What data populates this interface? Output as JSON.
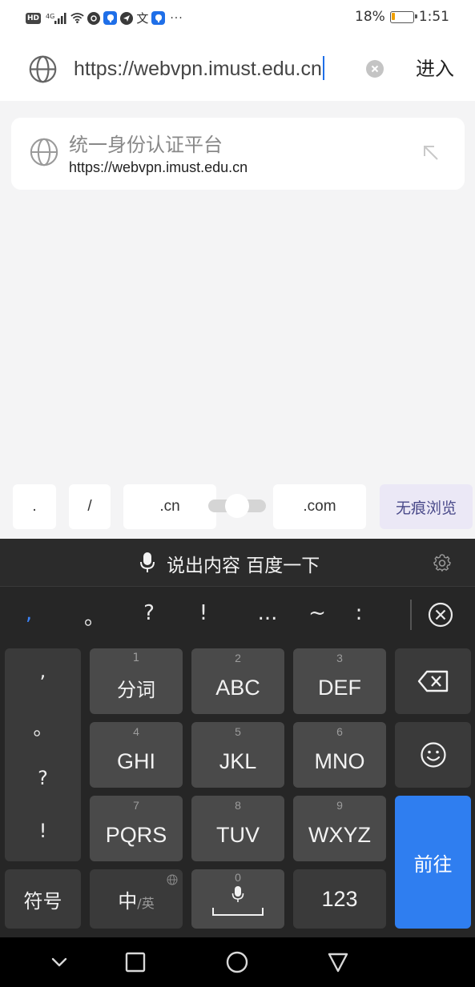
{
  "status_bar": {
    "hd": "HD",
    "network": "4G",
    "wen_icon_char": "文",
    "more_dots": "···",
    "battery_percent_label": "18%",
    "battery_level": 0.18,
    "battery_color": "#f0a000",
    "time": "1:51"
  },
  "address_bar": {
    "url_value": "https://webvpn.imust.edu.cn",
    "go_label": "进入"
  },
  "suggestion": {
    "title": "统一身份认证平台",
    "url": "https://webvpn.imust.edu.cn"
  },
  "quick_input": {
    "keys": [
      ".",
      "/",
      ".cn",
      ".com"
    ],
    "incognito_label": "无痕浏览"
  },
  "keyboard": {
    "voice_prompt": "说出内容 百度一下",
    "punctuation": [
      ",",
      "。",
      "?",
      "!",
      "...",
      "~",
      ":"
    ],
    "side_punctuation": [
      ",",
      "。",
      "?",
      "!"
    ],
    "keys": [
      {
        "num": "1",
        "label": "分词"
      },
      {
        "num": "2",
        "label": "ABC"
      },
      {
        "num": "3",
        "label": "DEF"
      },
      {
        "num": "4",
        "label": "GHI"
      },
      {
        "num": "5",
        "label": "JKL"
      },
      {
        "num": "6",
        "label": "MNO"
      },
      {
        "num": "7",
        "label": "PQRS"
      },
      {
        "num": "8",
        "label": "TUV"
      },
      {
        "num": "9",
        "label": "WXYZ"
      }
    ],
    "enter_label": "前往",
    "symbol_label": "符号",
    "lang_main": "中",
    "lang_sub": "/英",
    "space_num": "0",
    "num_mode_label": "123",
    "accent_color": "#2f7ef0"
  }
}
